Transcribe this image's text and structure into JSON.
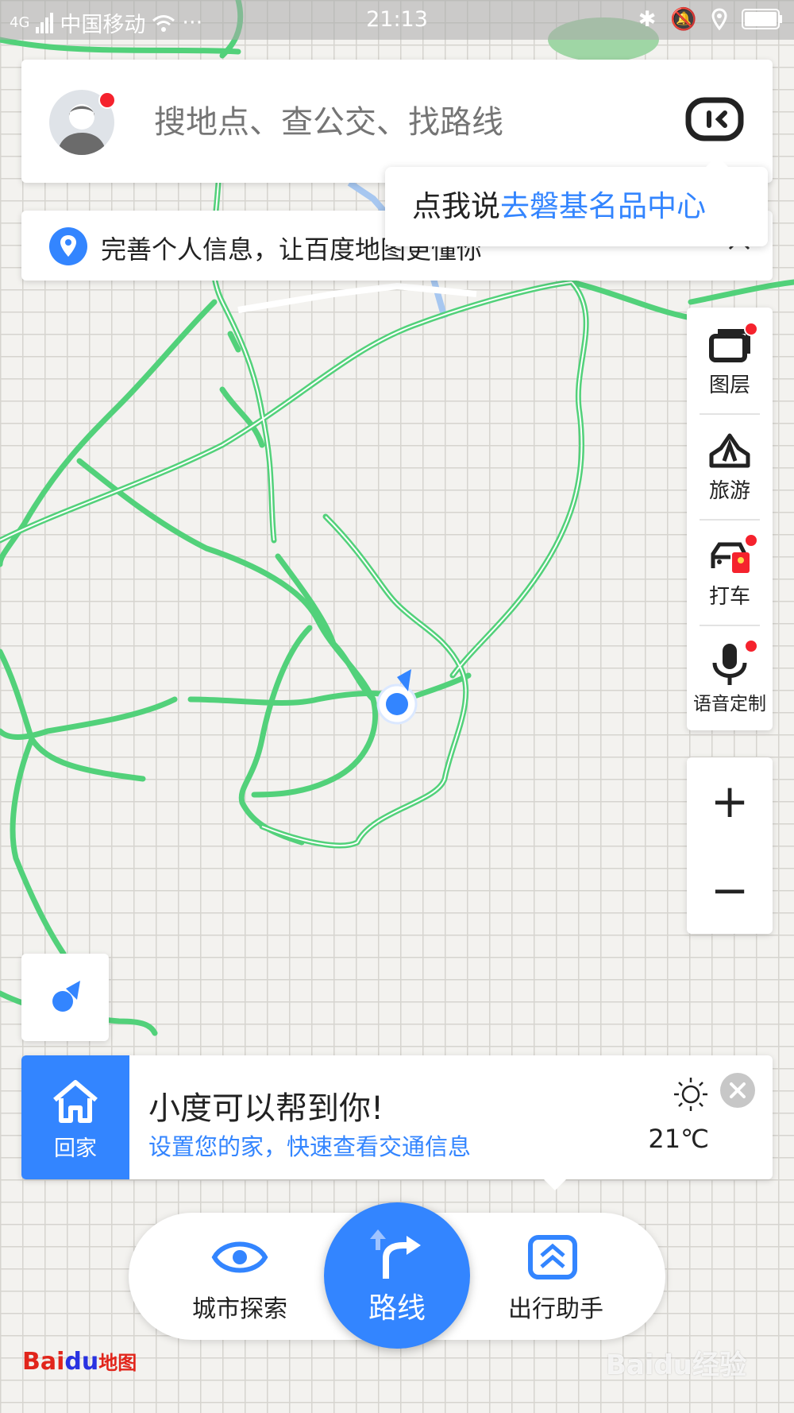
{
  "status_bar": {
    "network": "4G",
    "carrier": "中国移动",
    "more": "···",
    "time": "21:13"
  },
  "search": {
    "placeholder": "搜地点、查公交、找路线",
    "voice_icon": "voice-assistant-icon"
  },
  "voice_tip": {
    "prefix": "点我说",
    "highlight": "去磐基名品中心"
  },
  "profile_tip": {
    "text": "完善个人信息，让百度地图更懂你"
  },
  "right_panel": {
    "items": [
      {
        "label": "图层",
        "icon": "layers-icon"
      },
      {
        "label": "旅游",
        "icon": "travel-icon"
      },
      {
        "label": "打车",
        "icon": "taxi-icon"
      },
      {
        "label": "语音定制",
        "icon": "microphone-icon"
      }
    ]
  },
  "zoom": {
    "in": "+",
    "out": "−"
  },
  "home_card": {
    "label": "回家",
    "title": "小度可以帮到你!",
    "subtitle": "设置您的家，快速查看交通信息",
    "temperature": "21℃",
    "weather_icon": "sunny-icon"
  },
  "bottom_nav": {
    "explore": "城市探索",
    "route": "路线",
    "assistant": "出行助手"
  },
  "branding": {
    "logo_bai": "Bai",
    "logo_du": "du",
    "logo_map": "地图",
    "watermark": "Baidu经验"
  },
  "colors": {
    "accent": "#3385ff",
    "road": "#4cd47a",
    "alert": "#f5222d"
  }
}
